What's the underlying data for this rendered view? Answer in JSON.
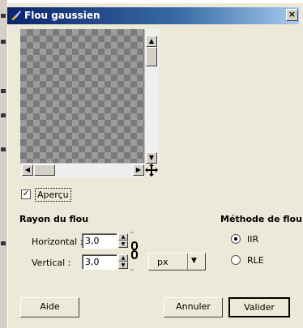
{
  "dialog": {
    "title": "Flou gaussien",
    "close_label": "×"
  },
  "icons": {
    "title": "brush-icon",
    "close": "close-icon",
    "move": "move-icon",
    "chain": "chain-link-icon"
  },
  "preview": {
    "checkbox_label": "Aperçu",
    "checked": true
  },
  "radius": {
    "section_title": "Rayon du flou",
    "horizontal_label": "Horizontal :",
    "horizontal_value": "3,0",
    "vertical_label": "Vertical :",
    "vertical_value": "3,0",
    "unit": "px"
  },
  "method": {
    "section_title": "Méthode de flou",
    "options": [
      {
        "label": "IIR",
        "selected": true
      },
      {
        "label": "RLE",
        "selected": false
      }
    ]
  },
  "buttons": {
    "help": "Aide",
    "cancel": "Annuler",
    "ok": "Valider"
  }
}
